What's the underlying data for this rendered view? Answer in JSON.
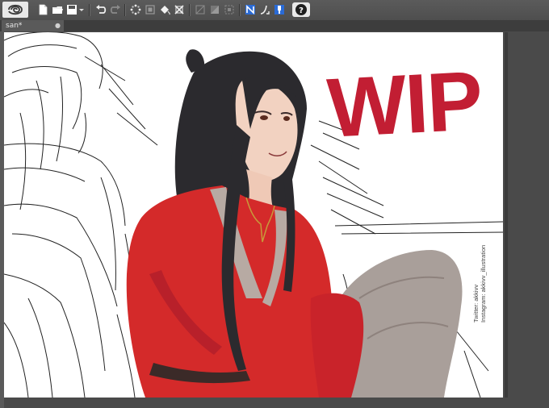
{
  "toolbar": {
    "items": [
      {
        "name": "app-logo-icon"
      },
      {
        "name": "new-file-icon"
      },
      {
        "name": "open-folder-icon"
      },
      {
        "name": "save-icon"
      },
      {
        "name": "dropdown-arrow-icon"
      },
      {
        "name": "undo-icon"
      },
      {
        "name": "redo-icon"
      },
      {
        "name": "loading-spinner-icon"
      },
      {
        "name": "transform-icon"
      },
      {
        "name": "fill-bucket-icon"
      },
      {
        "name": "crop-selection-icon"
      },
      {
        "name": "clear-selection-icon"
      },
      {
        "name": "invert-selection-icon"
      },
      {
        "name": "selection-border-icon"
      },
      {
        "name": "ruler-snap-icon"
      },
      {
        "name": "special-ruler-snap-icon"
      },
      {
        "name": "grid-snap-icon"
      },
      {
        "name": "help-icon"
      }
    ],
    "help_label": "?"
  },
  "tabs": [
    {
      "label": "san*",
      "close": "●"
    }
  ],
  "canvas": {
    "wip_text": "WIP",
    "credit_lines": [
      "Twitter: akkivv",
      "Instagram: akkivv_illustration"
    ]
  },
  "colors": {
    "accent": "#c21e33",
    "robe": "#d42a2a",
    "pants": "#a99f9a",
    "hair": "#2b2a2e",
    "ui_bg": "#4a4a4a"
  }
}
